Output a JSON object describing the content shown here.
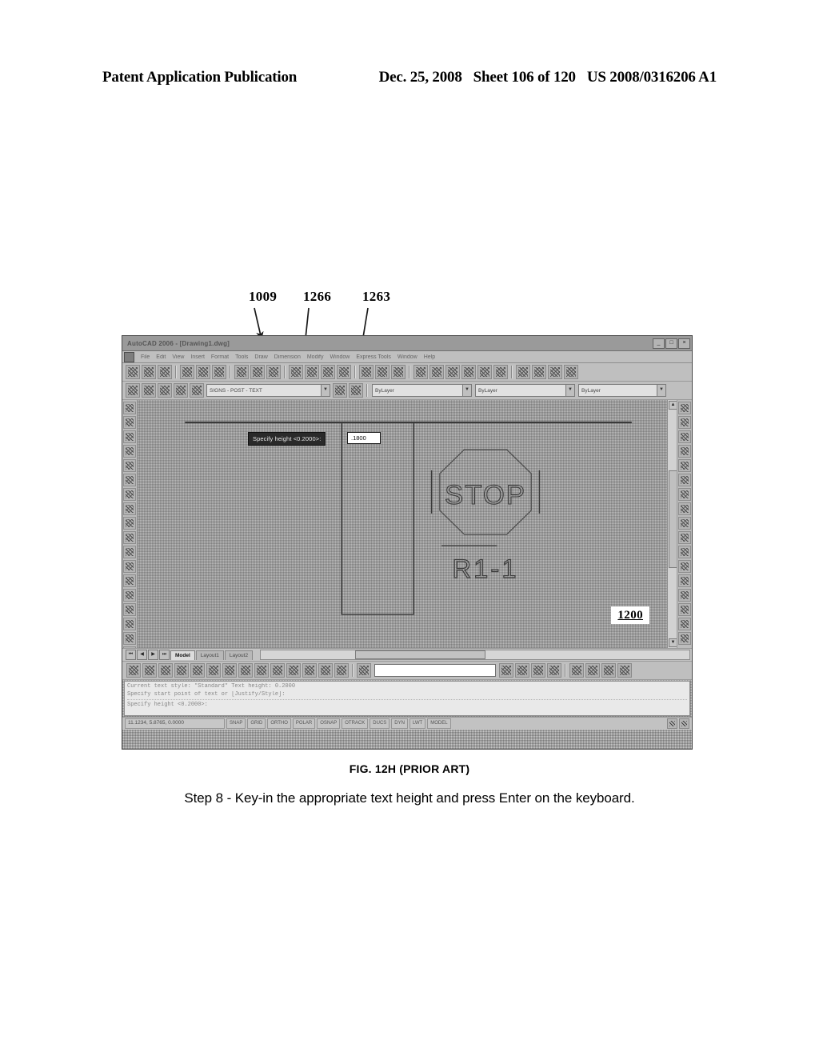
{
  "header": {
    "publication": "Patent Application Publication",
    "date": "Dec. 25, 2008",
    "sheet": "Sheet 106 of 120",
    "document_number": "US 2008/0316206 A1"
  },
  "callouts": [
    {
      "id": "1009",
      "label": "1009",
      "points_to": "application-title-bar"
    },
    {
      "id": "1266",
      "label": "1266",
      "points_to": "dynamic-input-prompt"
    },
    {
      "id": "1263",
      "label": "1263",
      "points_to": "dynamic-input-field"
    }
  ],
  "figure": {
    "label": "FIG. 12H (PRIOR ART)",
    "caption": "Step 8 - Key-in the appropriate text height and press Enter on the keyboard.",
    "drawing_reference": "1200"
  },
  "cad_window": {
    "title": "AutoCAD 2006 - [Drawing1.dwg]",
    "window_buttons": [
      "_",
      "□",
      "×"
    ],
    "menu_items": [
      "File",
      "Edit",
      "View",
      "Insert",
      "Format",
      "Tools",
      "Draw",
      "Dimension",
      "Modify",
      "Window",
      "Express Tools",
      "Window",
      "Help"
    ],
    "standard_toolbar_icons": [
      "new-icon",
      "open-icon",
      "save-icon",
      "plot-icon",
      "plot-preview-icon",
      "publish-icon",
      "cut-icon",
      "copy-icon",
      "paste-icon",
      "match-properties-icon",
      "undo-icon",
      "redo-icon",
      "pan-realtime-icon",
      "zoom-realtime-icon",
      "zoom-window-icon",
      "zoom-previous-icon",
      "properties-icon",
      "design-center-icon",
      "tool-palettes-icon",
      "sheet-set-manager-icon",
      "markup-set-icon",
      "help-icon",
      "text-style-icon",
      "dimension-style-icon",
      "multiline-text-icon",
      "block-icon"
    ],
    "layer_toolbar": {
      "layer_state_icon": "layer-states-icon",
      "layer_on_icon": "layer-on-icon",
      "layer_freeze_icon": "layer-freeze-icon",
      "layer_lock_icon": "layer-lock-icon",
      "layer_color_swatch": "layer-color-icon",
      "current_layer": "SIGNS - POST - TEXT",
      "color_value": "ByLayer",
      "linetype_value": "ByLayer",
      "lineweight_value": "ByLayer"
    },
    "draw_toolbar_icons": [
      "line-icon",
      "construction-line-icon",
      "polyline-icon",
      "polygon-icon",
      "rectangle-icon",
      "arc-icon",
      "circle-icon",
      "revision-cloud-icon",
      "spline-icon",
      "ellipse-icon",
      "ellipse-arc-icon",
      "insert-block-icon",
      "make-block-icon",
      "point-icon",
      "hatch-icon",
      "gradient-icon",
      "region-icon",
      "table-icon",
      "multiline-text-icon"
    ],
    "modify_toolbar_icons": [
      "erase-icon",
      "copy-icon",
      "mirror-icon",
      "offset-icon",
      "array-icon",
      "move-icon",
      "rotate-icon",
      "scale-icon",
      "stretch-icon",
      "trim-icon",
      "extend-icon",
      "break-at-point-icon",
      "break-icon",
      "join-icon",
      "chamfer-icon",
      "fillet-icon",
      "explode-icon"
    ],
    "dynamic_input": {
      "prompt": "Specify height <0.2000>:",
      "value": ".1800"
    },
    "drawing": {
      "sign_text": "STOP",
      "sign_designation": "R1-1"
    },
    "layout_tabs": {
      "nav_buttons": [
        "⏮",
        "◀",
        "▶",
        "⏭"
      ],
      "tabs": [
        "Model",
        "Layout1",
        "Layout2"
      ],
      "active_tab": "Model"
    },
    "bottom_toolbar_icons": [
      "dimlinear-icon",
      "dimaligned-icon",
      "dimordinate-icon",
      "dimradius-icon",
      "dimjogged-icon",
      "dimdiameter-icon",
      "dimangular-icon",
      "dimbaseline-icon",
      "dimcontinue-icon",
      "quick-leader-icon",
      "tolerance-icon",
      "center-mark-icon",
      "dimedit-icon",
      "dimtedit-icon",
      "dimupdate-icon",
      "dimstyle-icon",
      "text-style-icon",
      "multiline-text-icon",
      "edit-text-icon",
      "find-replace-icon",
      "scale-text-icon",
      "justify-text-icon",
      "arc-aligned-text-icon",
      "spell-check-icon"
    ],
    "command_history": [
      "Current text style: \"Standard\"  Text height:  0.2000",
      "Specify start point of text or [Justify/Style]:",
      "Specify height <0.2000>:"
    ],
    "status_bar": {
      "coordinates": "11.1234, 5.8765, 0.0000",
      "toggles": [
        "SNAP",
        "GRID",
        "ORTHO",
        "POLAR",
        "OSNAP",
        "OTRACK",
        "DUCS",
        "DYN",
        "LWT",
        "MODEL"
      ],
      "tray_icons": [
        "communication-center-icon",
        "manage-xrefs-icon"
      ]
    }
  }
}
